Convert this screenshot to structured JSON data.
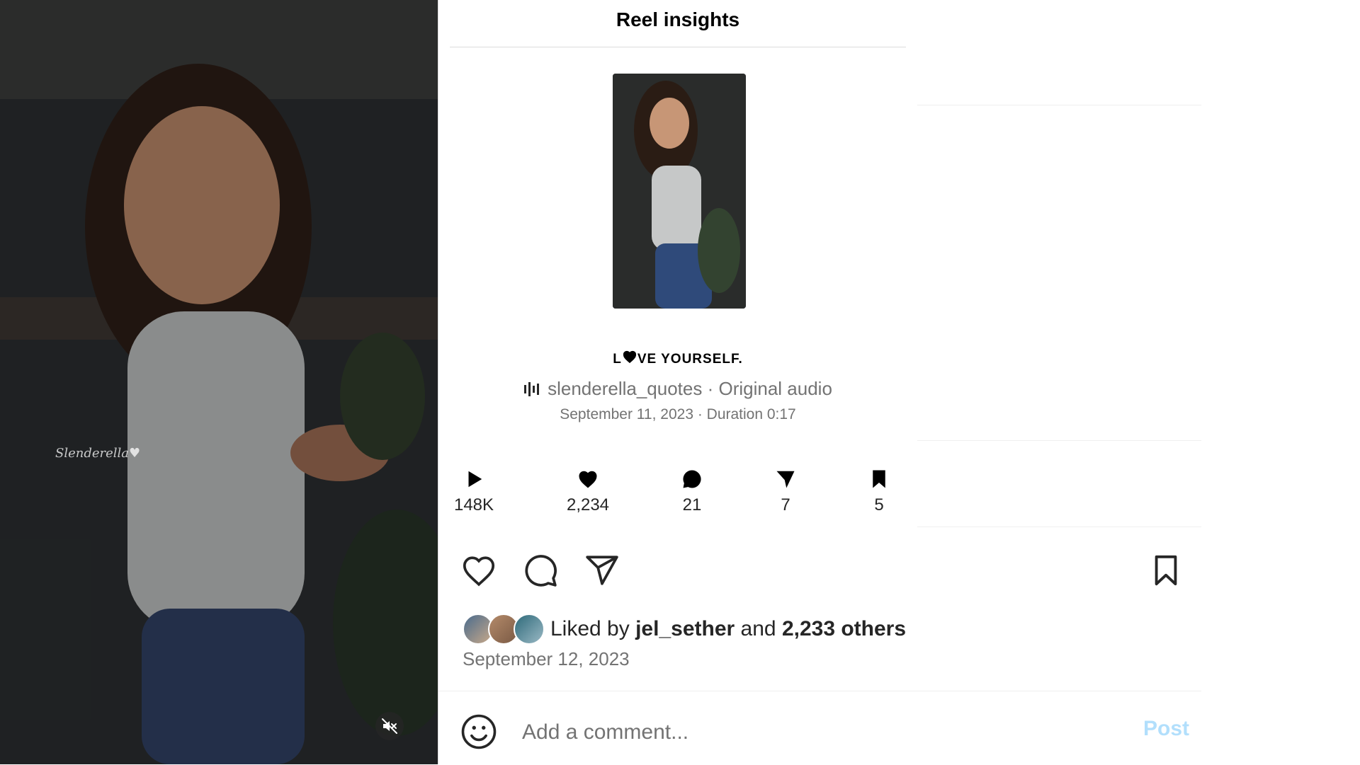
{
  "video": {
    "watermark": "Slenderella♥",
    "mute_icon": "speaker-muted-icon"
  },
  "insights": {
    "title": "Reel insights",
    "caption_pre": "L",
    "caption_post": "VE YOURSELF.",
    "audio_icon": "audio-waveform-icon",
    "audio_text": "slenderella_quotes · Original audio",
    "date_duration": "September 11, 2023 · Duration 0:17",
    "metrics": [
      {
        "icon": "play-icon",
        "value": "148K"
      },
      {
        "icon": "heart-filled-icon",
        "value": "2,234"
      },
      {
        "icon": "comment-filled-icon",
        "value": "21"
      },
      {
        "icon": "share-filled-icon",
        "value": "7"
      },
      {
        "icon": "bookmark-filled-icon",
        "value": "5"
      }
    ]
  },
  "actions": {
    "like_icon": "heart-outline-icon",
    "comment_icon": "comment-outline-icon",
    "share_icon": "share-outline-icon",
    "save_icon": "bookmark-outline-icon"
  },
  "likes": {
    "prefix": "Liked by",
    "user": "jel_sether",
    "and": "and",
    "others": "2,233 others"
  },
  "post_date": "September 12, 2023",
  "comment": {
    "placeholder": "Add a comment...",
    "post_label": "Post"
  },
  "colors": {
    "muted_text": "#737373",
    "post_button_disabled": "#b2dffc",
    "divider": "#dbdbdb"
  }
}
